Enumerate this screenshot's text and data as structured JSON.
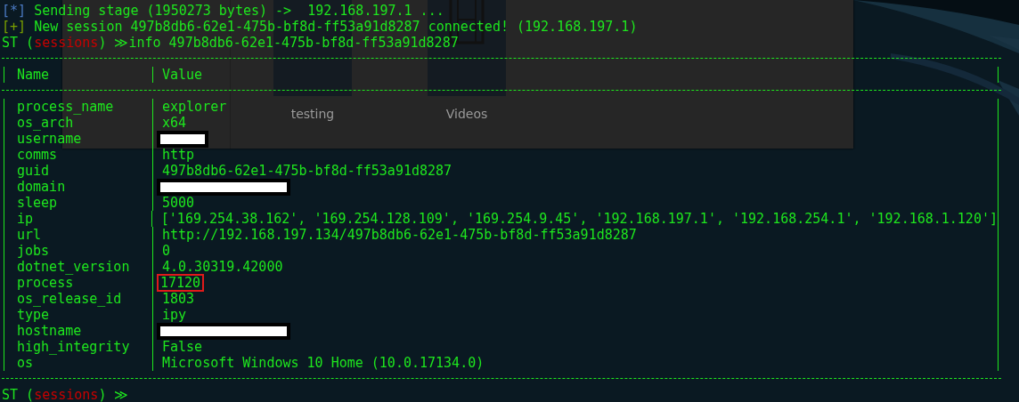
{
  "background_window": {
    "items": [
      {
        "kind": "folder",
        "label": "testing"
      },
      {
        "kind": "videos",
        "label": "Videos"
      }
    ]
  },
  "terminal": {
    "lines": [
      {
        "kind": "info",
        "marker": "[*]",
        "text": "Sending stage (1950273 bytes) ->  192.168.197.1 ..."
      },
      {
        "kind": "success",
        "marker": "[+]",
        "text": "New session 497b8db6-62e1-475b-bf8d-ff53a91d8287 connected! (192.168.197.1)"
      },
      {
        "kind": "prompt",
        "before": "ST (",
        "context": "sessions",
        "after": ") ≫",
        "command": "info 497b8db6-62e1-475b-bf8d-ff53a91d8287"
      }
    ],
    "table": {
      "columns": [
        "Name",
        "Value"
      ],
      "rows": [
        {
          "name": "process_name",
          "value": "explorer"
        },
        {
          "name": "os_arch",
          "value": "x64"
        },
        {
          "name": "username",
          "kind": "redacted_short"
        },
        {
          "name": "comms",
          "value": "http"
        },
        {
          "name": "guid",
          "value": "497b8db6-62e1-475b-bf8d-ff53a91d8287"
        },
        {
          "name": "domain",
          "kind": "redacted_long"
        },
        {
          "name": "sleep",
          "value": "5000"
        },
        {
          "name": "ip",
          "value": "['169.254.38.162', '169.254.128.109', '169.254.9.45', '192.168.197.1', '192.168.254.1', '192.168.1.120']"
        },
        {
          "name": "url",
          "value": "http://192.168.197.134/497b8db6-62e1-475b-bf8d-ff53a91d8287"
        },
        {
          "name": "jobs",
          "value": "0"
        },
        {
          "name": "dotnet_version",
          "value": "4.0.30319.42000"
        },
        {
          "name": "process",
          "value": "17120",
          "highlighted": true
        },
        {
          "name": "os_release_id",
          "value": "1803"
        },
        {
          "name": "type",
          "value": "ipy"
        },
        {
          "name": "hostname",
          "kind": "redacted_long"
        },
        {
          "name": "high_integrity",
          "value": "False"
        },
        {
          "name": "os",
          "value": "Microsoft Windows 10 Home (10.0.17134.0)"
        }
      ]
    },
    "final_prompt": {
      "before": "ST (",
      "context": "sessions",
      "after": ") ≫"
    }
  }
}
